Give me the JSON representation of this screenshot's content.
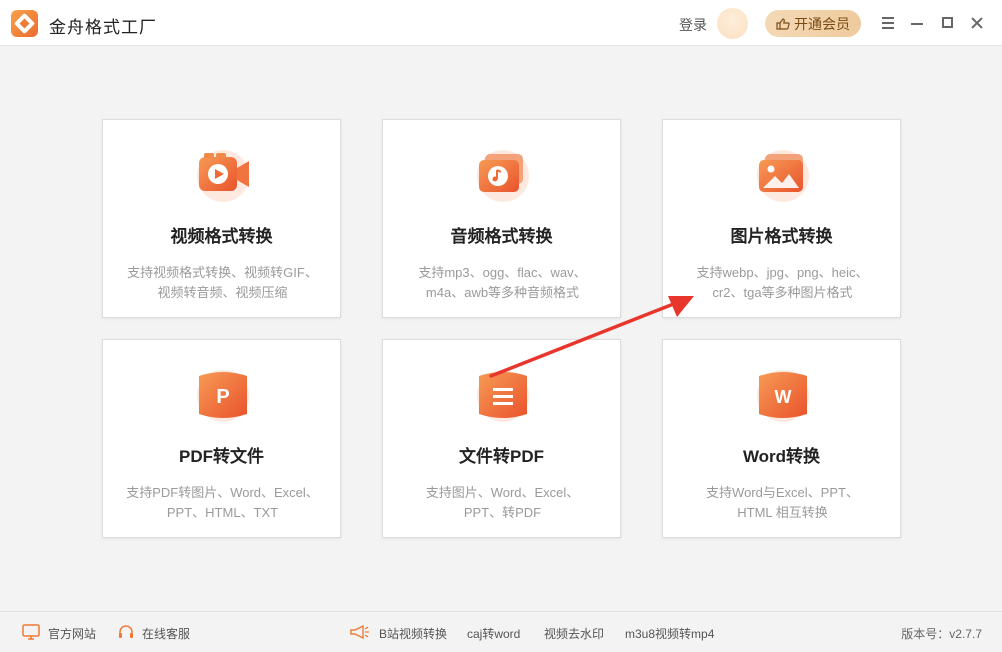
{
  "app": {
    "title": "金舟格式工厂"
  },
  "header": {
    "login_label": "登录",
    "vip_label": "开通会员"
  },
  "colors": {
    "accent": "#ef6a35",
    "vip_bg": "#f0cfa3",
    "arrow": "#e8362d"
  },
  "cards": [
    {
      "title": "视频格式转换",
      "desc1": "支持视频格式转换、视频转GIF、",
      "desc2": "视频转音频、视频压缩",
      "icon": "video-icon"
    },
    {
      "title": "音频格式转换",
      "desc1": "支持mp3、ogg、flac、wav、",
      "desc2": "m4a、awb等多种音频格式",
      "icon": "music-icon"
    },
    {
      "title": "图片格式转换",
      "desc1": "支持webp、jpg、png、heic、",
      "desc2": "cr2、tga等多种图片格式",
      "icon": "image-icon"
    },
    {
      "title": "PDF转文件",
      "desc1": "支持PDF转图片、Word、Excel、",
      "desc2": "PPT、HTML、TXT",
      "icon": "pdf-p-icon",
      "glyph": "P"
    },
    {
      "title": "文件转PDF",
      "desc1": "支持图片、Word、Excel、",
      "desc2": "PPT、转PDF",
      "icon": "document-icon"
    },
    {
      "title": "Word转换",
      "desc1": "支持Word与Excel、PPT、",
      "desc2": "HTML 相互转换",
      "icon": "word-w-icon",
      "glyph": "W"
    }
  ],
  "footer": {
    "official_site": "官方网站",
    "online_service": "在线客服",
    "bilibili": "B站视频转换",
    "caj": "caj转word",
    "watermark": "视频去水印",
    "m3u8": "m3u8视频转mp4",
    "version_label": "版本号：",
    "version": "v2.7.7"
  }
}
